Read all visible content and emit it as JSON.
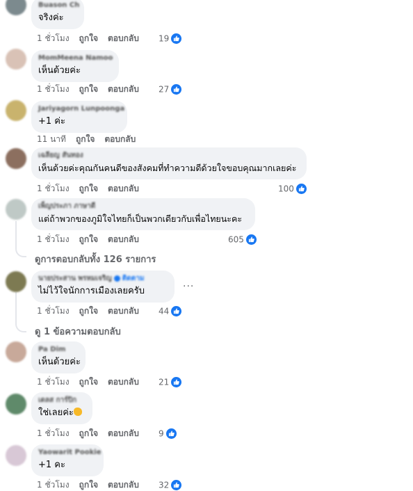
{
  "labels": {
    "like": "ถูกใจ",
    "reply": "ตอบกลับ"
  },
  "comments": [
    {
      "name": "Buason Ch",
      "text": "จริงค่ะ",
      "time": "1 ชั่วโมง",
      "reactions": "19"
    },
    {
      "name": "MomMeena Namoo",
      "text": "เห็นด้วยค่ะ",
      "time": "1 ชั่วโมง",
      "reactions": "27"
    },
    {
      "name": "Jariyagorn Lunpoonga",
      "text": "+1 ค่ะ",
      "time": "11 นาที",
      "reactions": ""
    },
    {
      "name": "เฉลียญ สันทอง",
      "text": "เห็นด้วยค่ะคุณกันคนดีของสังคมที่ทำความดีด้วยใจขอบคุณมากเลยค่ะ",
      "time": "1 ชั่วโมง",
      "reactions": "100"
    },
    {
      "name": "เพ็ญประภา ภาษาดี",
      "text": "แต่ถ้าพวกของภูมิใจไทยก็เป็นพวกเดียวกับเพื่อไทยนะคะ",
      "time": "1 ชั่วโมง",
      "reactions": "605"
    },
    {
      "name": "นายประสาน พรหมเจริญ",
      "follow": "ติดตาม",
      "text": "ไม่ไว้ใจนักการเมืองเลยครับ",
      "time": "1 ชั่วโมง",
      "reactions": "44"
    },
    {
      "name": "Pa Dim",
      "text": "เห็นด้วยค่ะ",
      "time": "1 ชั่วโมง",
      "reactions": "21"
    },
    {
      "name": "เดลส การ์ปิก",
      "text": "ใช่เลยค่ะ",
      "time": "1 ชั่วโมง",
      "reactions": "9"
    },
    {
      "name": "Yaowarit Pookie",
      "text": "+1 คะ",
      "time": "1 ชั่วโมง",
      "reactions": "32"
    }
  ],
  "view_replies_1": "ดูการตอบกลับทั้ง 126 รายการ",
  "view_replies_2": "ดู 1 ข้อความตอบกลับ",
  "more_options": "...",
  "colors": {
    "bubble": "#f0f2f5",
    "meta": "#65676b",
    "like_blue": "#1877f2"
  }
}
